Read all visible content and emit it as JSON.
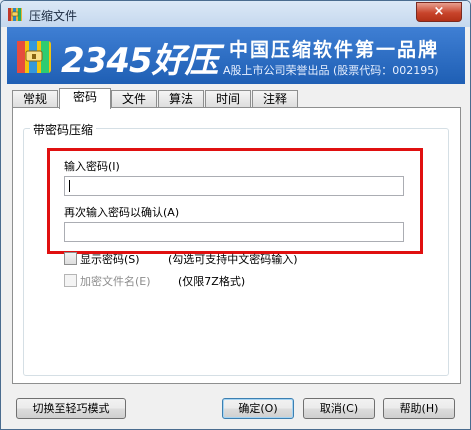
{
  "window": {
    "title": "压缩文件",
    "close_glyph": "×"
  },
  "banner": {
    "brand_name": "2345好压",
    "slogan": "中国压缩软件第一品牌",
    "subtext": "A股上市公司荣誉出品 (股票代码：002195)"
  },
  "tabs": [
    {
      "label": "常规",
      "active": false
    },
    {
      "label": "密码",
      "active": true
    },
    {
      "label": "文件",
      "active": false
    },
    {
      "label": "算法",
      "active": false
    },
    {
      "label": "时间",
      "active": false
    },
    {
      "label": "注释",
      "active": false
    }
  ],
  "password_group": {
    "legend": "带密码压缩",
    "password_label": "输入密码(I)",
    "password_value": "",
    "confirm_label": "再次输入密码以确认(A)",
    "confirm_value": ""
  },
  "options": {
    "show_password_label": "显示密码(S)",
    "show_password_checked": false,
    "show_password_hint": "(勾选可支持中文密码输入)",
    "encrypt_names_label": "加密文件名(E)",
    "encrypt_names_checked": false,
    "encrypt_names_hint": "(仅限7Z格式)"
  },
  "footer": {
    "simple_mode_label": "切换至轻巧模式",
    "ok_label": "确定(O)",
    "cancel_label": "取消(C)",
    "help_label": "帮助(H)"
  },
  "colors": {
    "banner_blue": "#2b6cc4",
    "highlight_red": "#e01010",
    "close_red": "#c8442b"
  }
}
